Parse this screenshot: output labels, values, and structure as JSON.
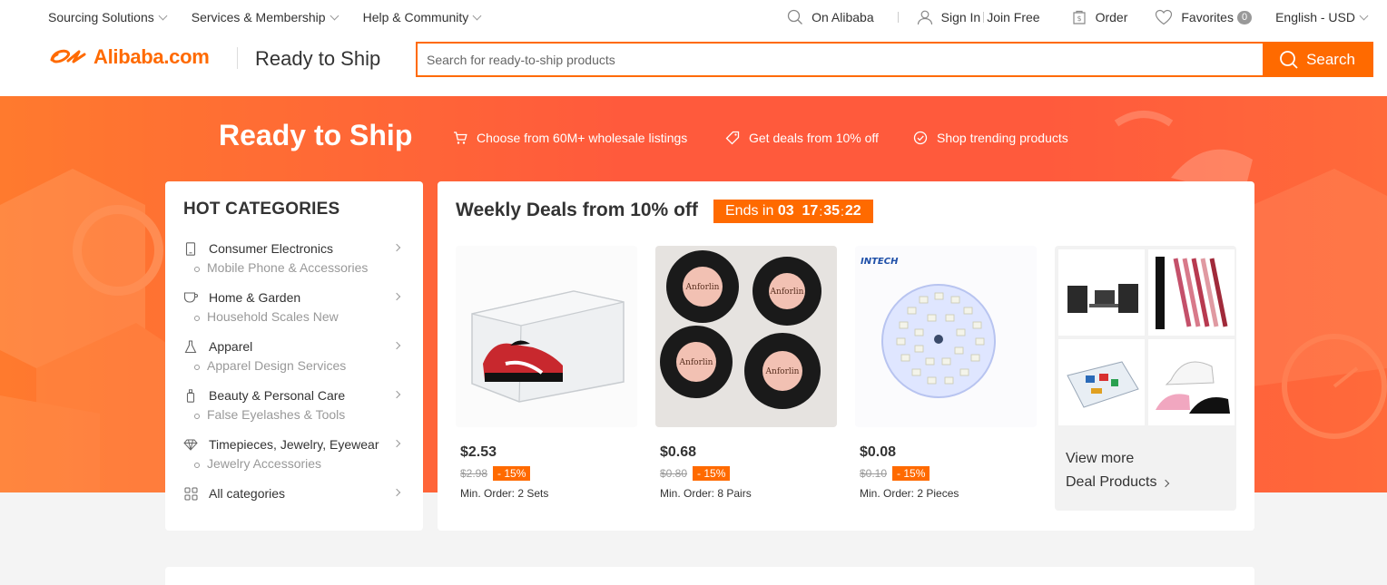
{
  "topnav": {
    "left": [
      {
        "label": "Sourcing Solutions"
      },
      {
        "label": "Services & Membership"
      },
      {
        "label": "Help & Community"
      }
    ],
    "on_alibaba": "On Alibaba",
    "sign_in": "Sign In",
    "join_free": "Join Free",
    "order": "Order",
    "favorites": "Favorites",
    "favorites_count": "0",
    "language": "English - USD"
  },
  "header": {
    "logo_text": "Alibaba.com",
    "section_title": "Ready to Ship",
    "search_placeholder": "Search for ready-to-ship products",
    "search_button": "Search"
  },
  "banner": {
    "title": "Ready to Ship",
    "features": [
      {
        "icon": "cart-icon",
        "label": "Choose from 60M+ wholesale listings"
      },
      {
        "icon": "tag-icon",
        "label": "Get deals from 10% off"
      },
      {
        "icon": "check-circle-icon",
        "label": "Shop trending products"
      }
    ]
  },
  "categories": {
    "heading": "HOT CATEGORIES",
    "items": [
      {
        "icon": "phone-icon",
        "label": "Consumer Electronics",
        "sub": "Mobile Phone & Accessories"
      },
      {
        "icon": "cup-icon",
        "label": "Home & Garden",
        "sub": "Household Scales New"
      },
      {
        "icon": "flask-icon",
        "label": "Apparel",
        "sub": "Apparel Design Services"
      },
      {
        "icon": "bottle-icon",
        "label": "Beauty & Personal Care",
        "sub": "False Eyelashes & Tools"
      },
      {
        "icon": "diamond-icon",
        "label": "Timepieces, Jewelry, Eyewear",
        "sub": "Jewelry Accessories"
      }
    ],
    "all_label": "All categories"
  },
  "deals": {
    "title": "Weekly Deals from 10% off",
    "timer_prefix": "Ends in",
    "timer_days": "03",
    "timer_hours": "17",
    "timer_minutes": "35",
    "timer_seconds": "22",
    "products": [
      {
        "price": "$2.53",
        "old_price": "$2.98",
        "discount": "- 15%",
        "min_order": "Min. Order: 2 Sets"
      },
      {
        "price": "$0.68",
        "old_price": "$0.80",
        "discount": "- 15%",
        "min_order": "Min. Order: 8 Pairs"
      },
      {
        "price": "$0.08",
        "old_price": "$0.10",
        "discount": "- 15%",
        "min_order": "Min. Order: 2 Pieces"
      }
    ],
    "lash_brand": "Anforlin",
    "led_brand": "INTECH",
    "view_more_line1": "View more",
    "view_more_line2": "Deal Products"
  },
  "colors": {
    "accent": "#ff6a00",
    "banner": "#ff5a3c"
  }
}
